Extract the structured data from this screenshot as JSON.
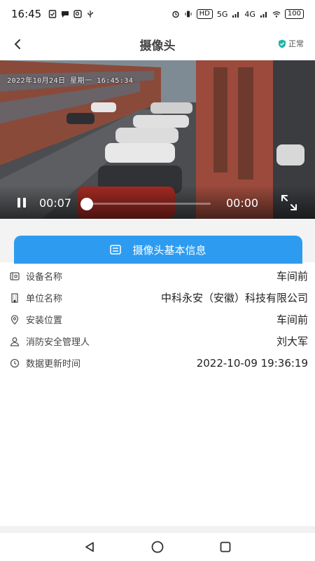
{
  "status_bar": {
    "time": "16:45",
    "network_5g": "5G",
    "network_4g": "4G",
    "hd": "HD",
    "battery": "100"
  },
  "header": {
    "title": "摄像头",
    "status_label": "正常",
    "status_color": "#1fb5a8"
  },
  "video": {
    "overlay_timestamp": "2022年10月24日  星期一  16:45:34",
    "current_time": "00:07",
    "duration": "00:00",
    "progress": 0.0
  },
  "info_section": {
    "tab_label": "摄像头基本信息",
    "accent_color": "#2d9cf0",
    "rows": [
      {
        "icon": "device-icon",
        "label": "设备名称",
        "value": "车间前"
      },
      {
        "icon": "building-icon",
        "label": "单位名称",
        "value": "中科永安（安徽）科技有限公司"
      },
      {
        "icon": "location-pin-icon",
        "label": "安装位置",
        "value": "车间前"
      },
      {
        "icon": "person-icon",
        "label": "消防安全管理人",
        "value": "刘大军"
      },
      {
        "icon": "clock-icon",
        "label": "数据更新时间",
        "value": "2022-10-09 19:36:19"
      }
    ]
  }
}
